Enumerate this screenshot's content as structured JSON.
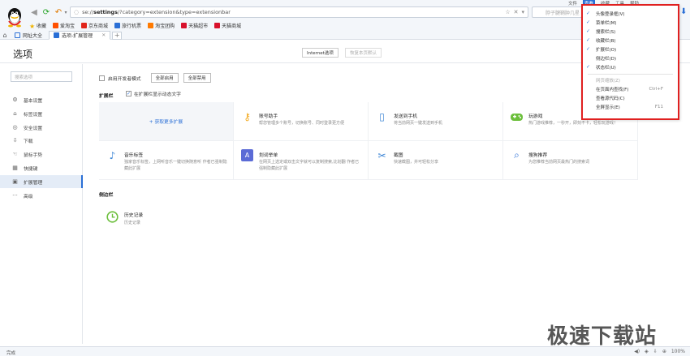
{
  "browser": {
    "address_scheme": "se://",
    "address_path": "settings",
    "address_query": "/?category=extension&type=extensionbar",
    "search_placeholder": "脖子腱鞘肿几星",
    "topbar": [
      "文件",
      "查看",
      "收藏",
      "工具",
      "帮助"
    ],
    "bookmarks": [
      {
        "label": "收藏",
        "color": "#f0b400"
      },
      {
        "label": "爱淘宝",
        "color": "#ff5000"
      },
      {
        "label": "京东商城",
        "color": "#e1251b"
      },
      {
        "label": "旅行机票",
        "color": "#2a6fd6"
      },
      {
        "label": "淘宝团购",
        "color": "#ff7a00"
      },
      {
        "label": "天猫超市",
        "color": "#d8112c"
      },
      {
        "label": "天猫商城",
        "color": "#d8112c"
      }
    ],
    "tabs": [
      {
        "label": "网址大全",
        "active": false
      },
      {
        "label": "选项-扩展管理",
        "active": true
      }
    ]
  },
  "header": {
    "title": "选项",
    "internet_options": "Internet选项",
    "restore_defaults": "恢复本页默认"
  },
  "sidebar": {
    "search_placeholder": "搜索选项",
    "items": [
      {
        "label": "基本设置",
        "icon": "gear-icon",
        "glyph": "⚙",
        "active": false
      },
      {
        "label": "标签设置",
        "icon": "tag-icon",
        "glyph": "⌂",
        "active": false
      },
      {
        "label": "安全设置",
        "icon": "shield-icon",
        "glyph": "◎",
        "active": false
      },
      {
        "label": "下载",
        "icon": "download-icon",
        "glyph": "⇩",
        "active": false
      },
      {
        "label": "鼠标手势",
        "icon": "mouse-gesture-icon",
        "glyph": "☜",
        "active": false
      },
      {
        "label": "快捷键",
        "icon": "keyboard-icon",
        "glyph": "▦",
        "active": false
      },
      {
        "label": "扩展管理",
        "icon": "extension-icon",
        "glyph": "▣",
        "active": true
      },
      {
        "label": "高级",
        "icon": "more-icon",
        "glyph": "···",
        "active": false
      }
    ]
  },
  "content": {
    "dev_mode_label": "启用开发者模式",
    "enable_all": "全部启用",
    "disable_all": "全部禁用",
    "extension_bar_title": "扩展栏",
    "show_text_label": "在扩展栏显示动态文字",
    "get_more": "+ 获取更多扩展",
    "extensions": [
      {
        "name": "账号助手",
        "desc": "帮您管理多个账号，切换账号、同时登录更方便",
        "icon": "key-icon",
        "glyph": "🔑",
        "color": "#f2a81d"
      },
      {
        "name": "发送到手机",
        "desc": "将当前网页一键发送到手机",
        "icon": "send-to-phone-icon",
        "glyph": "📱",
        "color": "#3f87d6"
      },
      {
        "name": "玩游戏",
        "desc": "热门游戏推荐，一秒开，即刻不卡，轻松玩游戏！",
        "icon": "gamepad-icon",
        "glyph": "🎮",
        "color": "#6cbf3c"
      },
      {
        "name": "音乐标签",
        "desc": "独家音乐标签，上网听音乐一键切换随意听 作者已强制隐藏此扩展",
        "icon": "music-icon",
        "glyph": "♪",
        "color": "#3f87d6"
      },
      {
        "name": "划词举单",
        "desc": "在网页上选定或双击文字就可以复制搜索,比划翻 作者已强制隐藏此扩展",
        "icon": "translate-icon",
        "glyph": "划",
        "color": "#5b6bd6"
      },
      {
        "name": "截图",
        "desc": "快速截图，并可轻松分享",
        "icon": "scissors-icon",
        "glyph": "✂",
        "color": "#3f87d6"
      },
      {
        "name": "搜狗推荐",
        "desc": "为您推荐当前网页最热门的搜索词",
        "icon": "search-recommend-icon",
        "glyph": "🔍",
        "color": "#2a6fd6"
      }
    ],
    "sidebar_bar_title": "侧边栏",
    "history": {
      "name": "历史记录",
      "desc": "历史记录",
      "icon": "clock-icon"
    }
  },
  "menu": {
    "items": [
      {
        "label": "头像登录框(V)",
        "checked": true,
        "disabled": false,
        "shortcut": ""
      },
      {
        "label": "菜单栏(M)",
        "checked": true,
        "disabled": false,
        "shortcut": ""
      },
      {
        "label": "搜索栏(S)",
        "checked": true,
        "disabled": false,
        "shortcut": ""
      },
      {
        "label": "收藏栏(B)",
        "checked": true,
        "disabled": false,
        "shortcut": ""
      },
      {
        "label": "扩展栏(O)",
        "checked": true,
        "disabled": false,
        "shortcut": ""
      },
      {
        "label": "侧边栏(D)",
        "checked": false,
        "disabled": false,
        "shortcut": ""
      },
      {
        "label": "状态栏(U)",
        "checked": true,
        "disabled": false,
        "shortcut": ""
      },
      {
        "label": "网页缩放(Z)",
        "checked": false,
        "disabled": true,
        "shortcut": ""
      },
      {
        "label": "在页面内查找(F)",
        "checked": false,
        "disabled": false,
        "shortcut": "Ctrl+F"
      },
      {
        "label": "查看源代码(C)",
        "checked": false,
        "disabled": false,
        "shortcut": ""
      },
      {
        "label": "全屏显示(E)",
        "checked": false,
        "disabled": false,
        "shortcut": "F11"
      }
    ]
  },
  "status": {
    "text": "完成",
    "zoom": "100%"
  },
  "watermark": "极速下载站"
}
